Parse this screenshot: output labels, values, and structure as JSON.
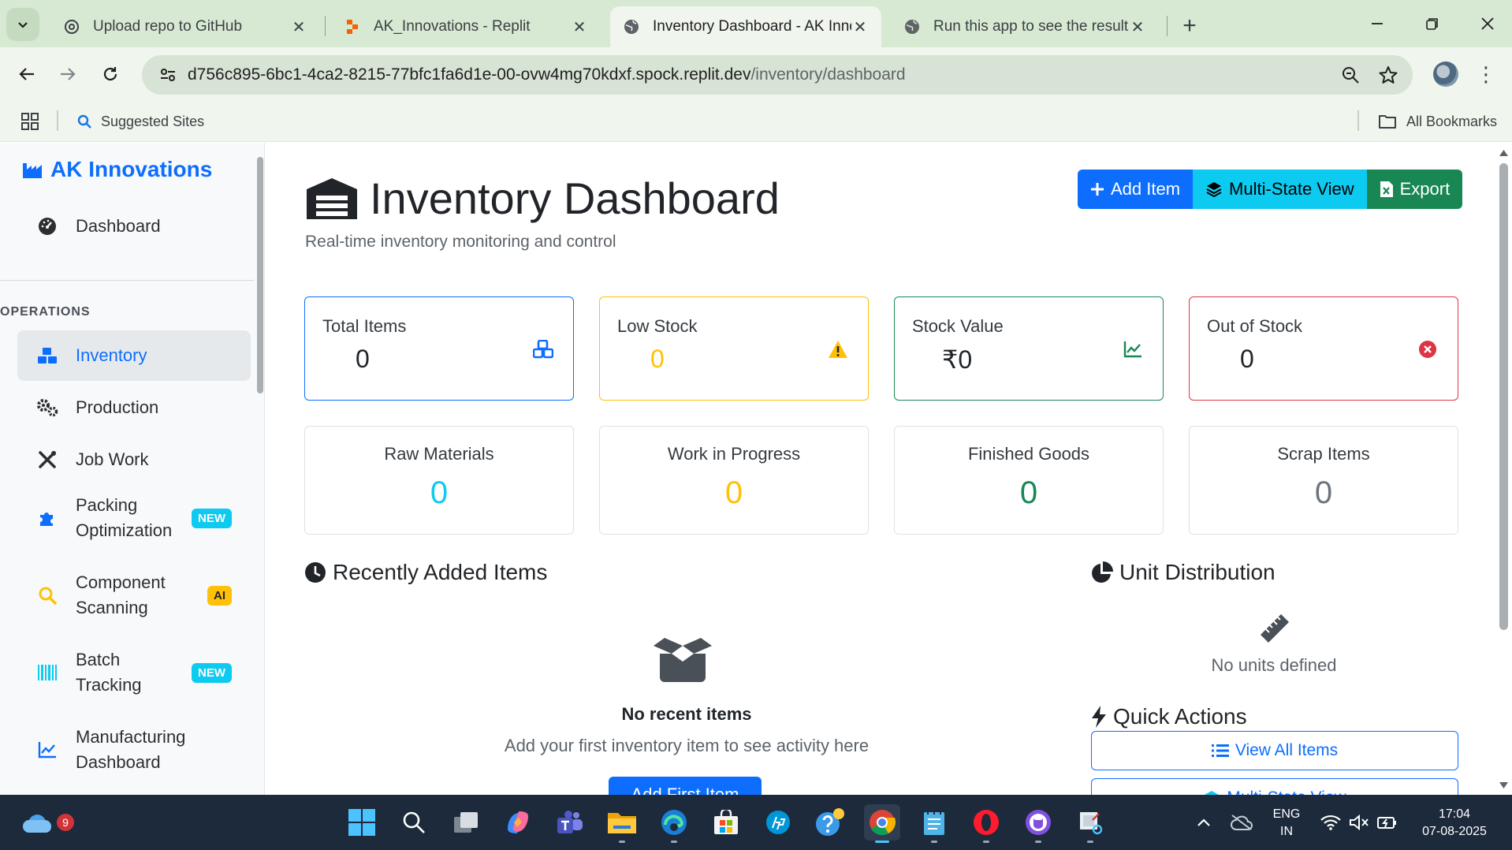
{
  "browser": {
    "tabs": [
      {
        "title": "Upload repo to GitHub",
        "icon": "openai-icon",
        "active": false
      },
      {
        "title": "AK_Innovations - Replit",
        "icon": "replit-icon",
        "active": false
      },
      {
        "title": "Inventory Dashboard - AK Innov",
        "icon": "globe-icon",
        "active": true
      },
      {
        "title": "Run this app to see the results l",
        "icon": "globe-icon",
        "active": false
      }
    ],
    "url_host": "d756c895-6bc1-4ca2-8215-77bfc1fa6d1e-00-ovw4mg70kdxf.spock.replit.dev",
    "url_path": "/inventory/dashboard",
    "bookmarks": {
      "suggested": "Suggested Sites",
      "all": "All Bookmarks"
    }
  },
  "sidebar": {
    "brand": "AK Innovations",
    "top_link": "Dashboard",
    "section": "OPERATIONS",
    "items": [
      {
        "label": "Inventory",
        "icon": "boxes-icon",
        "active": true,
        "badge": ""
      },
      {
        "label": "Production",
        "icon": "cogs-icon",
        "active": false,
        "badge": ""
      },
      {
        "label": "Job Work",
        "icon": "tools-icon",
        "active": false,
        "badge": ""
      },
      {
        "label": "Packing Optimization",
        "icon": "puzzle-icon",
        "active": false,
        "badge": "NEW"
      },
      {
        "label": "Component Scanning",
        "icon": "search-icon",
        "active": false,
        "badge": "AI"
      },
      {
        "label": "Batch Tracking",
        "icon": "barcode-icon",
        "active": false,
        "badge": "NEW"
      },
      {
        "label": "Manufacturing Dashboard",
        "icon": "chart-line-icon",
        "active": false,
        "badge": ""
      }
    ]
  },
  "header": {
    "title": "Inventory Dashboard",
    "subtitle": "Real-time inventory monitoring and control",
    "buttons": {
      "add": "Add Item",
      "multistate": "Multi-State View",
      "export": "Export"
    }
  },
  "stats": [
    {
      "label": "Total Items",
      "value": "0",
      "color": "#0d6efd",
      "icon": "cubes-icon"
    },
    {
      "label": "Low Stock",
      "value": "0",
      "color": "#ffc107",
      "icon": "warning-icon"
    },
    {
      "label": "Stock Value",
      "value": "₹0",
      "color": "#198754",
      "icon": "chart-line-icon"
    },
    {
      "label": "Out of Stock",
      "value": "0",
      "color": "#dc3545",
      "icon": "times-circle-icon"
    }
  ],
  "states": [
    {
      "label": "Raw Materials",
      "value": "0",
      "color": "#0dcaf0"
    },
    {
      "label": "Work in Progress",
      "value": "0",
      "color": "#ffc107"
    },
    {
      "label": "Finished Goods",
      "value": "0",
      "color": "#198754"
    },
    {
      "label": "Scrap Items",
      "value": "0",
      "color": "#6c757d"
    }
  ],
  "recent": {
    "title": "Recently Added Items",
    "empty_title": "No recent items",
    "empty_sub": "Add your first inventory item to see activity here",
    "button": "Add First Item"
  },
  "units": {
    "title": "Unit Distribution",
    "empty": "No units defined"
  },
  "quick_actions": {
    "title": "Quick Actions",
    "view_all": "View All Items",
    "second": "Multi-State View"
  },
  "taskbar": {
    "weather_badge": "9",
    "lang_line1": "ENG",
    "lang_line2": "IN",
    "time": "17:04",
    "date": "07-08-2025"
  }
}
